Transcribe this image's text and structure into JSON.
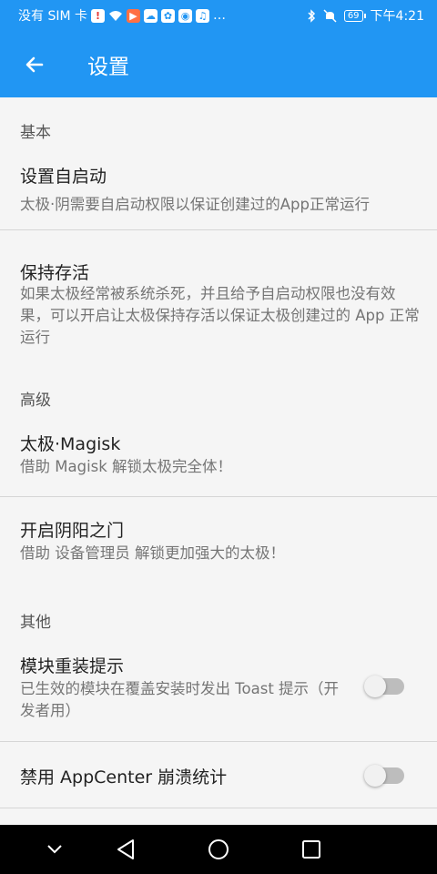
{
  "status_bar": {
    "carrier": "没有 SIM 卡",
    "icons_left": [
      "sim-warning-icon",
      "wifi-icon",
      "play-app-icon",
      "cloud-app-icon",
      "baidu-app-icon",
      "bulb-app-icon",
      "music-app-icon",
      "more-icon"
    ],
    "icons_right": [
      "bluetooth-icon",
      "mute-icon"
    ],
    "battery": "69",
    "time": "下午4:21"
  },
  "app_bar": {
    "title": "设置",
    "color": "#2196f3"
  },
  "sections": {
    "basic": "基本",
    "advanced": "高级",
    "other": "其他"
  },
  "items": {
    "auto_start": {
      "title": "设置自启动",
      "subtitle": "太极·阴需要自启动权限以保证创建过的App正常运行"
    },
    "keep_alive": {
      "title": "保持存活",
      "subtitle": "如果太极经常被系统杀死，并且给予自启动权限也没有效果，可以开启让太极保持存活以保证太极创建过的 App 正常运行"
    },
    "magisk": {
      "title": "太极·Magisk",
      "subtitle": "借助 Magisk 解锁太极完全体！"
    },
    "yinyang_gate": {
      "title": "开启阴阳之门",
      "subtitle": "借助 设备管理员 解锁更加强大的太极！"
    },
    "module_reinstall": {
      "title": "模块重装提示",
      "subtitle": "已生效的模块在覆盖安装时发出 Toast 提示（开发者用）",
      "enabled": false
    },
    "disable_appcenter": {
      "title": "禁用 AppCenter 崩溃统计",
      "enabled": false
    }
  },
  "nav_bar": [
    "hide-nav-icon",
    "back-triangle-icon",
    "home-circle-icon",
    "recents-square-icon"
  ]
}
